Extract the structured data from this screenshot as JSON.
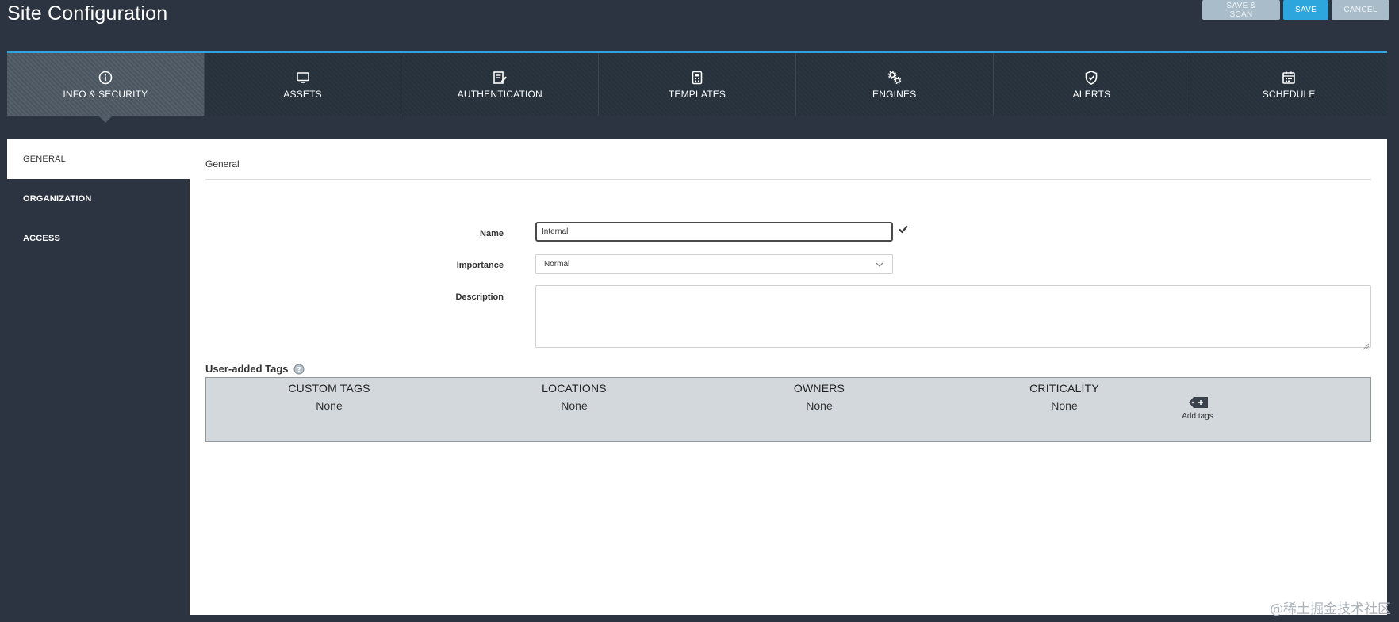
{
  "header": {
    "title": "Site Configuration",
    "buttons": {
      "save_and_scan": "SAVE & SCAN",
      "save": "SAVE",
      "cancel": "CANCEL"
    }
  },
  "tabs": [
    {
      "label": "INFO & SECURITY",
      "icon": "info-icon",
      "active": true
    },
    {
      "label": "ASSETS",
      "icon": "monitor-icon",
      "active": false
    },
    {
      "label": "AUTHENTICATION",
      "icon": "edit-document-icon",
      "active": false
    },
    {
      "label": "TEMPLATES",
      "icon": "template-icon",
      "active": false
    },
    {
      "label": "ENGINES",
      "icon": "gears-icon",
      "active": false
    },
    {
      "label": "ALERTS",
      "icon": "shield-check-icon",
      "active": false
    },
    {
      "label": "SCHEDULE",
      "icon": "calendar-icon",
      "active": false
    }
  ],
  "sidebar": {
    "items": [
      {
        "label": "GENERAL",
        "active": true
      },
      {
        "label": "ORGANIZATION",
        "active": false
      },
      {
        "label": "ACCESS",
        "active": false
      }
    ]
  },
  "general": {
    "section_title": "General",
    "name_label": "Name",
    "name_value": "Internal",
    "importance_label": "Importance",
    "importance_value": "Normal",
    "description_label": "Description",
    "description_value": ""
  },
  "tags": {
    "heading": "User-added Tags",
    "columns": [
      {
        "header": "CUSTOM TAGS",
        "value": "None"
      },
      {
        "header": "LOCATIONS",
        "value": "None"
      },
      {
        "header": "OWNERS",
        "value": "None"
      },
      {
        "header": "CRITICALITY",
        "value": "None"
      }
    ],
    "add_tags_label": "Add tags"
  },
  "watermark": "@稀土掘金技术社区",
  "colors": {
    "accent": "#2da5dd",
    "background": "#2b3440",
    "panel": "#ffffff",
    "tags_box": "#d3d8dc"
  }
}
